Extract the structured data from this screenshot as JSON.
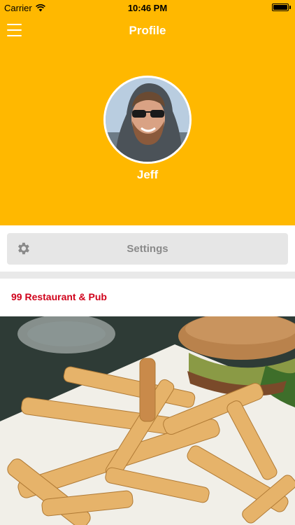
{
  "status_bar": {
    "carrier": "Carrier",
    "time": "10:46 PM"
  },
  "nav": {
    "title": "Profile",
    "menu_icon": "hamburger-menu-icon"
  },
  "profile": {
    "name": "Jeff"
  },
  "settings": {
    "label": "Settings",
    "icon": "gear-icon"
  },
  "post": {
    "title": "99 Restaurant & Pub"
  },
  "colors": {
    "header": "#FFB800",
    "accent_text": "#D0021B",
    "button_bg": "#E6E6E6",
    "button_text": "#8A8A8A"
  }
}
